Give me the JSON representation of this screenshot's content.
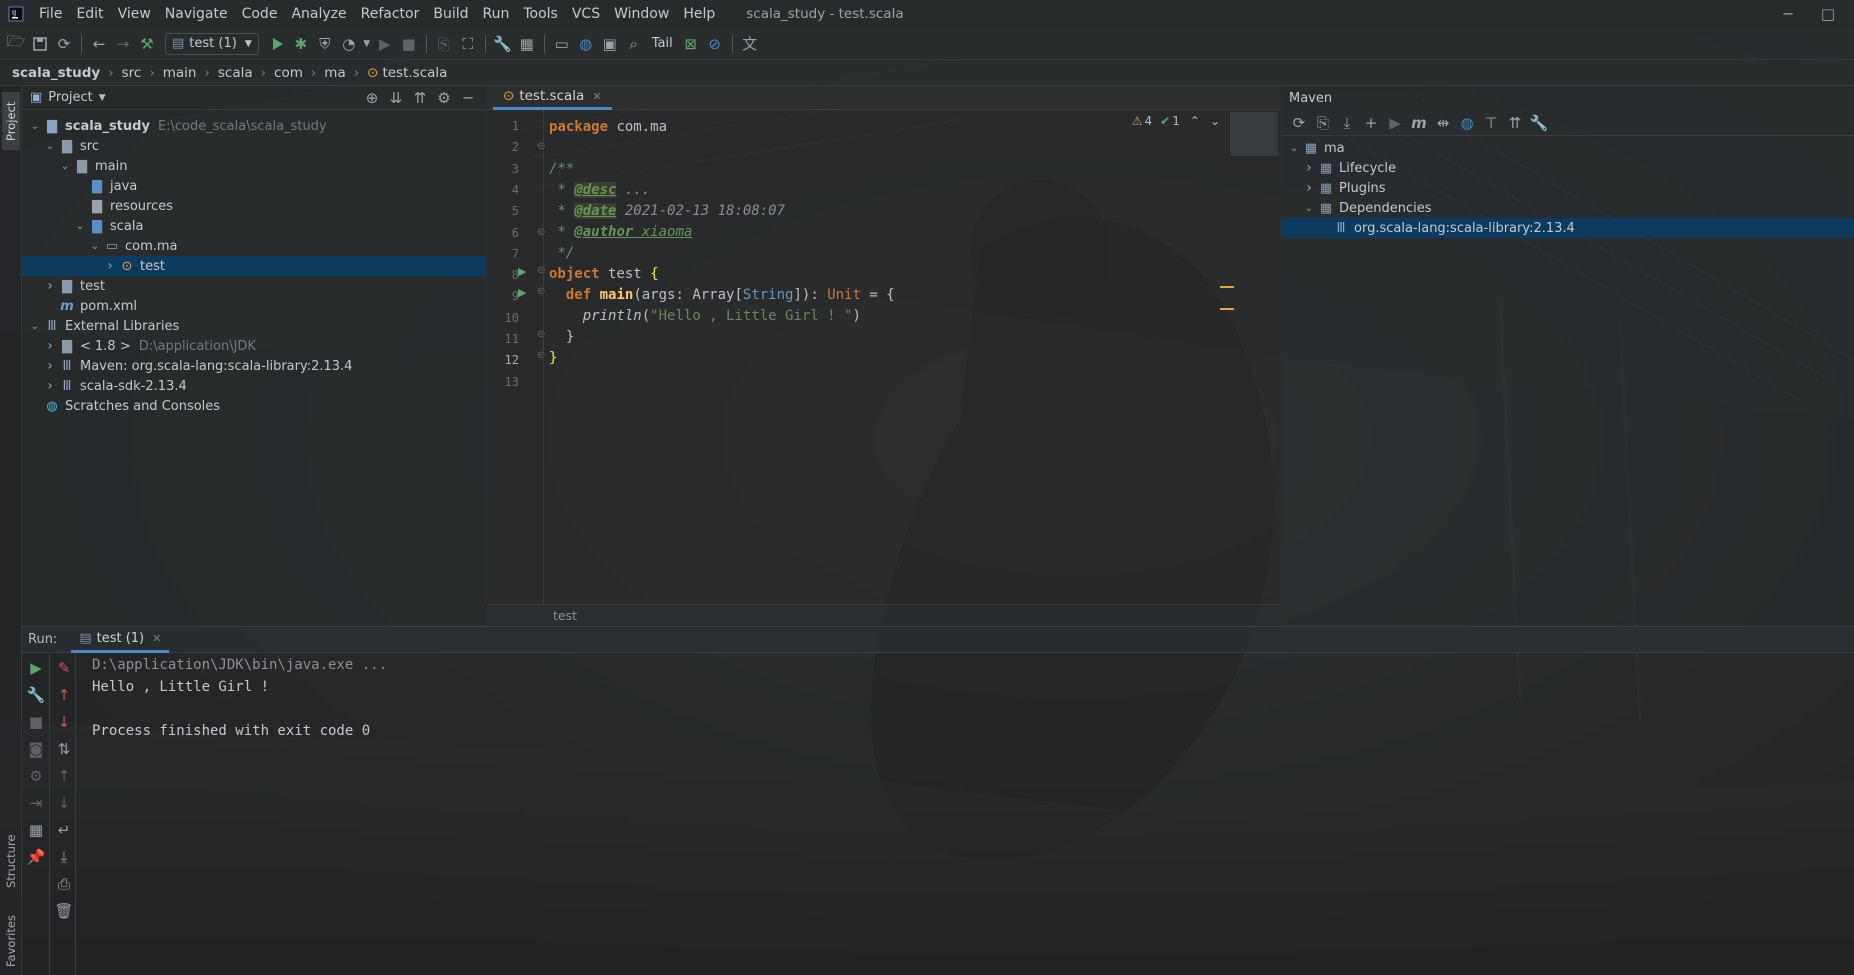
{
  "window": {
    "title": "scala_study - test.scala"
  },
  "menu": [
    "File",
    "Edit",
    "View",
    "Navigate",
    "Code",
    "Analyze",
    "Refactor",
    "Build",
    "Run",
    "Tools",
    "VCS",
    "Window",
    "Help"
  ],
  "toolbar": {
    "run_config": "test (1)",
    "tail_label": "Tail"
  },
  "breadcrumb": [
    "scala_study",
    "src",
    "main",
    "scala",
    "com",
    "ma",
    "test.scala"
  ],
  "left_strip": {
    "project_tab": "Project",
    "structure_tab": "Structure",
    "favorites_tab": "Favorites"
  },
  "project": {
    "header": "Project",
    "tree": [
      {
        "label": "scala_study",
        "hint": "E:\\code_scala\\scala_study",
        "depth": 0,
        "open": true,
        "icon": "module-folder-icon"
      },
      {
        "label": "src",
        "depth": 1,
        "open": true,
        "icon": "folder-icon"
      },
      {
        "label": "main",
        "depth": 2,
        "open": true,
        "icon": "folder-icon"
      },
      {
        "label": "java",
        "depth": 3,
        "icon": "source-folder-icon"
      },
      {
        "label": "resources",
        "depth": 3,
        "icon": "resources-folder-icon"
      },
      {
        "label": "scala",
        "depth": 3,
        "open": true,
        "icon": "source-folder-icon"
      },
      {
        "label": "com.ma",
        "depth": 4,
        "open": true,
        "icon": "package-icon"
      },
      {
        "label": "test",
        "depth": 5,
        "open": false,
        "icon": "scala-object-icon",
        "selected": true
      },
      {
        "label": "test",
        "depth": 1,
        "open": false,
        "icon": "folder-icon"
      },
      {
        "label": "pom.xml",
        "depth": 1,
        "icon": "maven-file-icon"
      },
      {
        "label": "External Libraries",
        "depth": 0,
        "open": true,
        "icon": "library-icon"
      },
      {
        "label": "< 1.8 >",
        "hint": "D:\\application\\JDK",
        "depth": 1,
        "open": false,
        "icon": "jdk-icon"
      },
      {
        "label": "Maven: org.scala-lang:scala-library:2.13.4",
        "depth": 1,
        "open": false,
        "icon": "library-icon"
      },
      {
        "label": "scala-sdk-2.13.4",
        "depth": 1,
        "open": false,
        "icon": "library-icon"
      },
      {
        "label": "Scratches and Consoles",
        "depth": 0,
        "icon": "scratches-icon"
      }
    ]
  },
  "editor": {
    "tab": "test.scala",
    "warnings": "4",
    "checks": "1",
    "line_numbers": [
      "1",
      "2",
      "3",
      "4",
      "5",
      "6",
      "7",
      "8",
      "9",
      "10",
      "11",
      "12",
      "13"
    ],
    "code": {
      "l1_kw": "package",
      "l1_rest": " com.ma",
      "l3": "/**",
      "l4_star": " * ",
      "l4_tag": "@desc",
      "l4_rest": " ...",
      "l5_star": " * ",
      "l5_tag": "@date",
      "l5_rest": " 2021-02-13 18:08:07",
      "l6_star": " * ",
      "l6_tag": "@author",
      "l6_rest": " xiaoma",
      "l7": " */",
      "l8_kw": "object",
      "l8_name": " test ",
      "l8_brace": "{",
      "l9_ind": "  ",
      "l9_kw": "def",
      "l9_sp": " ",
      "l9_fn": "main",
      "l9_a": "(args: Array[",
      "l9_ty": "String",
      "l9_b": "]): ",
      "l9_unit": "Unit",
      "l9_c": " = {",
      "l10_ind": "    ",
      "l10_fn": "println",
      "l10_p": "(",
      "l10_str": "\"Hello , Little Girl ! \"",
      "l10_q": ")",
      "l11": "  }",
      "l12": "}"
    },
    "bottom_crumb": "test"
  },
  "maven": {
    "header": "Maven",
    "tree": [
      {
        "label": "ma",
        "depth": 0,
        "open": true,
        "icon": "maven-project-icon"
      },
      {
        "label": "Lifecycle",
        "depth": 1,
        "open": false,
        "icon": "lifecycle-folder-icon"
      },
      {
        "label": "Plugins",
        "depth": 1,
        "open": false,
        "icon": "plugins-folder-icon"
      },
      {
        "label": "Dependencies",
        "depth": 1,
        "open": true,
        "icon": "dependencies-folder-icon"
      },
      {
        "label": "org.scala-lang:scala-library:2.13.4",
        "depth": 2,
        "icon": "library-icon",
        "selected": true
      }
    ]
  },
  "run": {
    "label": "Run:",
    "tab": "test (1)",
    "console": [
      "D:\\application\\JDK\\bin\\java.exe ...",
      "Hello , Little Girl !",
      "",
      "Process finished with exit code 0"
    ]
  },
  "colors": {
    "accent": "#4a88c7",
    "selection": "#0d3a5f",
    "keyword": "#cc7832",
    "string": "#6a8759",
    "doc": "#629755",
    "run_green": "#59a869",
    "warning": "#e8a33d"
  }
}
